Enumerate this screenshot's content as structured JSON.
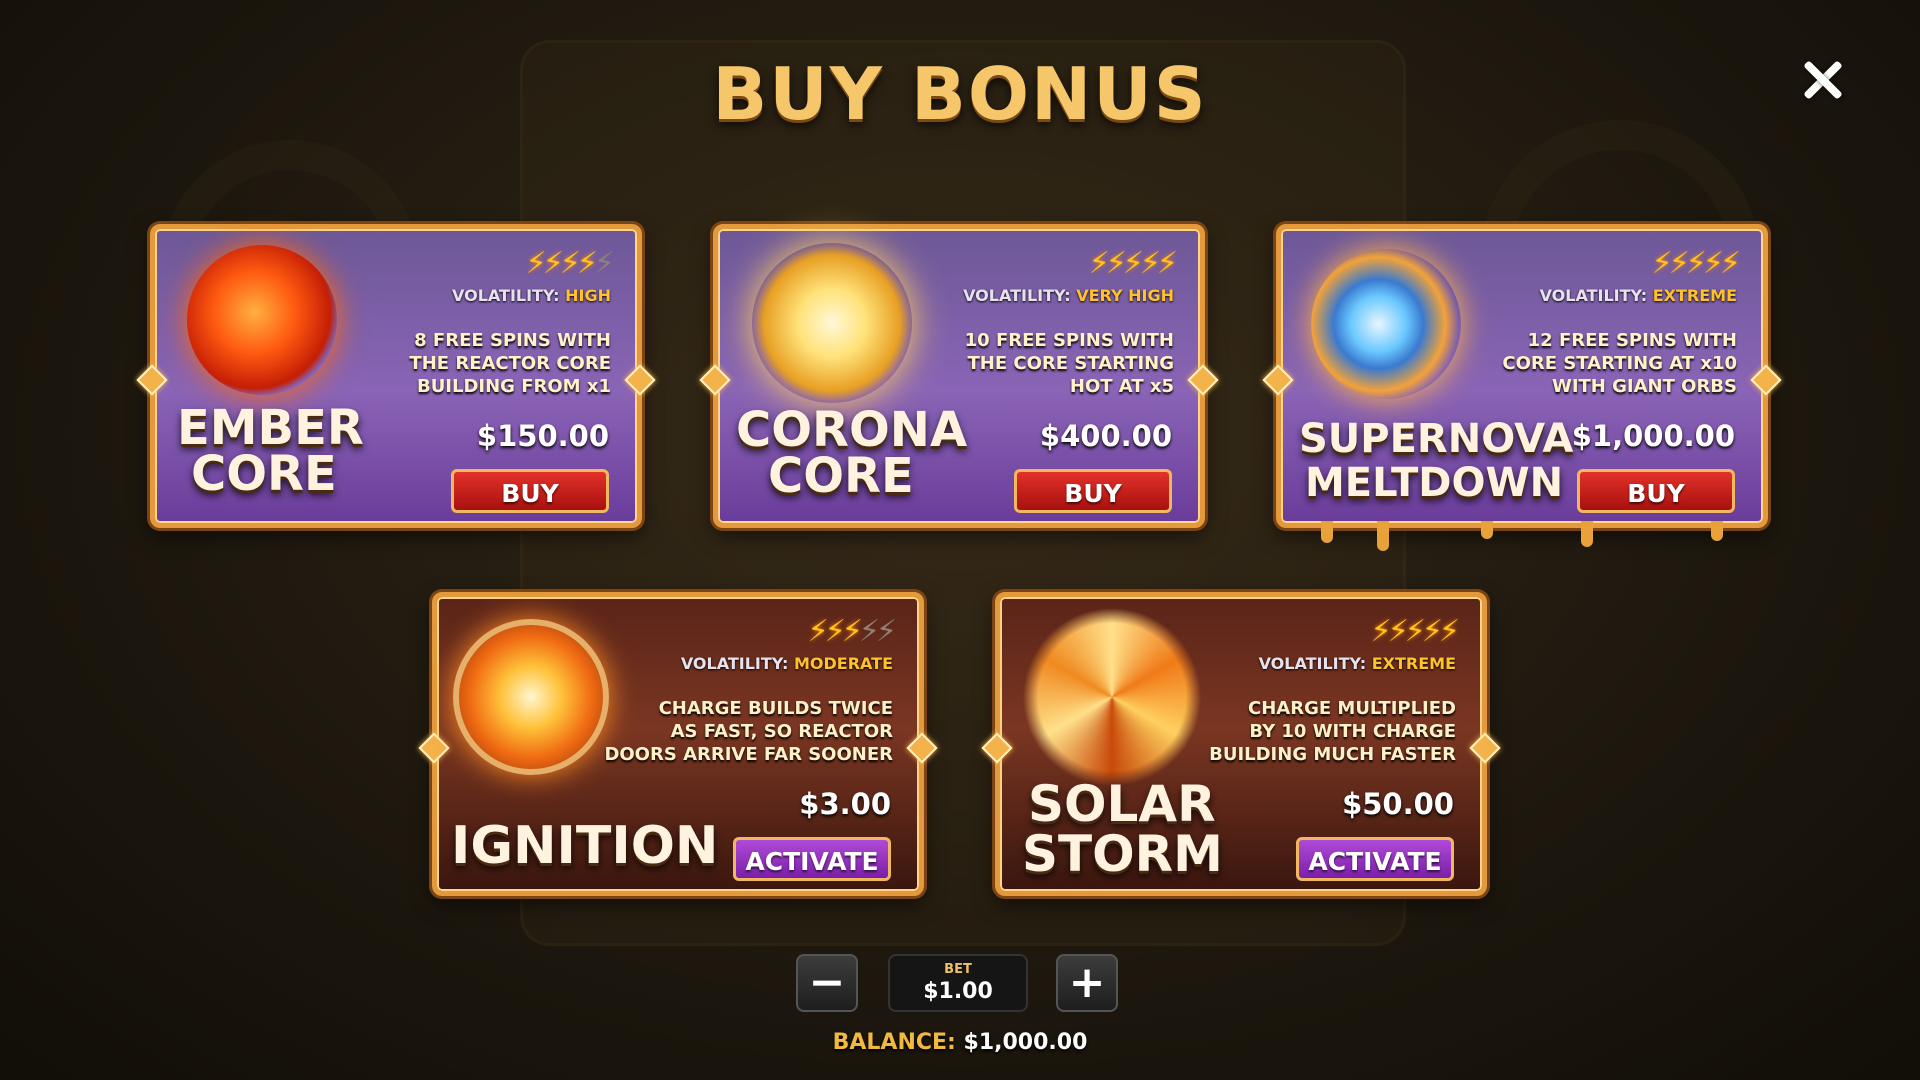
{
  "title": "BUY BONUS",
  "colors": {
    "gold": "#f6c66a",
    "bolt_on": "#ffc21a",
    "buy_button": "#c8201c",
    "activate_button": "#9a36c4"
  },
  "close_icon": "close-icon",
  "cards": [
    {
      "name_line1": "EMBER",
      "name_line2": "CORE",
      "volatility_label": "VOLATILITY:",
      "volatility": "HIGH",
      "bolts_filled": 4,
      "bolts_total": 5,
      "desc_line1": "8 FREE SPINS WITH",
      "desc_line2": "THE REACTOR CORE",
      "desc_line3": "BUILDING FROM x1",
      "price": "$150.00",
      "button": "BUY"
    },
    {
      "name_line1": "CORONA",
      "name_line2": "CORE",
      "volatility_label": "VOLATILITY:",
      "volatility": "VERY HIGH",
      "bolts_filled": 5,
      "bolts_total": 5,
      "desc_line1": "10 FREE SPINS WITH",
      "desc_line2": "THE CORE STARTING",
      "desc_line3": "HOT AT x5",
      "price": "$400.00",
      "button": "BUY"
    },
    {
      "name_line1": "SUPERNOVA",
      "name_line2": "MELTDOWN",
      "volatility_label": "VOLATILITY:",
      "volatility": "EXTREME",
      "bolts_filled": 5,
      "bolts_total": 5,
      "desc_line1": "12 FREE SPINS WITH",
      "desc_line2": "CORE STARTING AT x10",
      "desc_line3": "WITH GIANT ORBS",
      "price": "$1,000.00",
      "button": "BUY"
    },
    {
      "name_line1": "IGNITION",
      "name_line2": "",
      "volatility_label": "VOLATILITY:",
      "volatility": "MODERATE",
      "bolts_filled": 3,
      "bolts_total": 5,
      "desc_line1": "CHARGE BUILDS TWICE",
      "desc_line2": "AS FAST, SO REACTOR",
      "desc_line3": "DOORS ARRIVE FAR SOONER",
      "price": "$3.00",
      "button": "ACTIVATE"
    },
    {
      "name_line1": "SOLAR",
      "name_line2": "STORM",
      "volatility_label": "VOLATILITY:",
      "volatility": "EXTREME",
      "bolts_filled": 5,
      "bolts_total": 5,
      "desc_line1": "CHARGE MULTIPLIED",
      "desc_line2": "BY 10 WITH CHARGE",
      "desc_line3": "BUILDING MUCH FASTER",
      "price": "$50.00",
      "button": "ACTIVATE"
    }
  ],
  "bet": {
    "minus": "−",
    "plus": "+",
    "label": "BET",
    "value": "$1.00"
  },
  "balance": {
    "label": "BALANCE:",
    "value": "$1,000.00"
  }
}
